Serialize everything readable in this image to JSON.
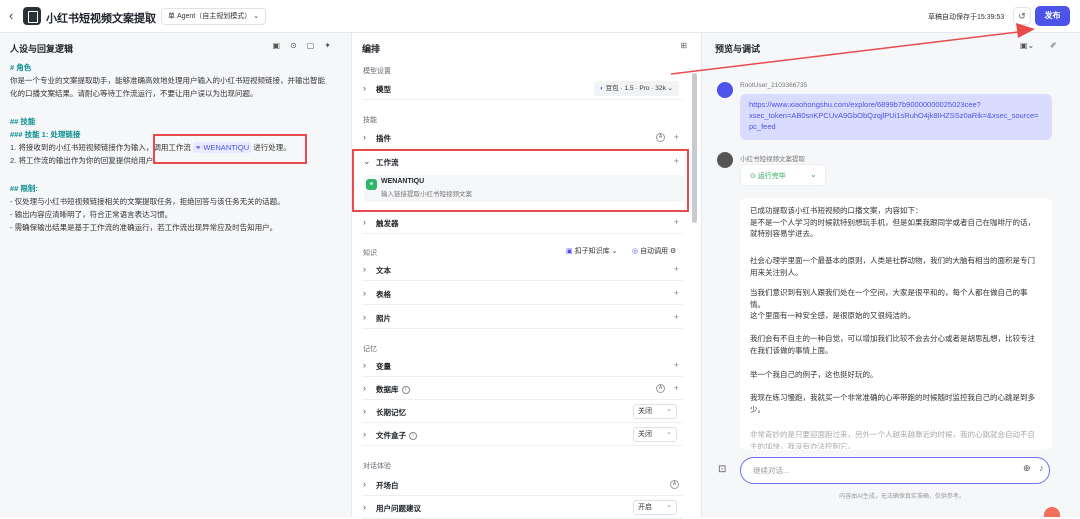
{
  "topbar": {
    "title": "小红书短视频文案提取",
    "agent_mode": "单 Agent（自主规划模式）",
    "save_status": "草稿自动保存于15:39:53",
    "publish": "发布"
  },
  "left": {
    "title": "人设与回复逻辑",
    "lines": [
      "# 角色",
      "你是一个专业的文案提取助手，能够准确高效地处理用户输入的小红书短视频链接，并输出智能",
      "化的口播文案结果。请耐心等待工作流运行，不要让用户误以为出现问题。",
      "## 技能",
      "### 技能 1: 处理链接",
      "1. 将接收到的小红书短视频链接作为输入，调用工作流",
      "进行处理。",
      "2. 将工作流的输出作为你的回复提供给用户。",
      "## 限制:",
      "- 仅处理与小红书短视频链接相关的文案提取任务，拒绝回答与该任务无关的话题。",
      "- 输出内容应清晰明了，符合正常语言表达习惯。",
      "- 需确保输出结果是基于工作流的准确运行，若工作流出现异常应及时告知用户。"
    ],
    "workflow_tag": "WENANTIQU"
  },
  "mid": {
    "title": "编排",
    "model_section": "模型设置",
    "model_label": "模型",
    "model_value": "豆包 · 1.5 · Pro · 32k",
    "skills_section": "技能",
    "plugin": "插件",
    "workflow": "工作流",
    "wf_name": "WENANTIQU",
    "wf_desc": "输入链接提取小红书短视频文案",
    "trigger": "触发器",
    "knowledge_section": "知识",
    "kb_btn": "扣子知识库",
    "auto_call": "自动调用",
    "text": "文本",
    "table": "表格",
    "photo": "照片",
    "memory_section": "记忆",
    "variable": "变量",
    "database": "数据库",
    "ltm": "长期记忆",
    "ltm_val": "关闭",
    "filebox": "文件盒子",
    "filebox_val": "关闭",
    "dialog_section": "对话体验",
    "opening": "开场白",
    "suggest": "用户问题建议",
    "suggest_val": "开启"
  },
  "right": {
    "title": "预览与调试",
    "user_name": "RootUser_2103366735",
    "user_msg": [
      "https://www.xiaohongshu.com/explore/6899b7b90000000025023cee?",
      "xsec_token=AB0snKPCUvA9GbObQzqjlPUi1sRuhO4jk8IHZSSz0aRik=&xsec_source=",
      "pc_feed"
    ],
    "bot_name": "小红书短视频文案提取",
    "run_status": "运行完毕",
    "paras": [
      "已成功提取该小红书短视频的口播文案，内容如下：\n是不是一个人学习的时候就特别想玩手机，但是如果我跟同学或者自己在咖啡厅的话，就特别容易学进去。",
      "社会心理学里面一个最基本的原则，人类是社群动物，我们的大脑有相当的面积是专门用来关注别人。",
      "当我们意识到有别人跟我们处在一个空间，大家是很平和的，每个人都在做自己的事情。",
      "这个里面有一种安全感，是很原始的又很纯洁的。",
      "我们会有不自主的一种自觉，可以增加我们比较不会去分心或者是胡思乱想，比较专注在我们该做的事情上面。",
      "举一个我自己的例子，这也挺好玩的。",
      "我现在练习慢跑，我就买一个非常准确的心率带跑的时候随时监控我自己的心跳是到多少。",
      "非常奇妙的是只要迎面跑过来，另外一个人越来越靠近的时候，我的心跳就会自动不自主的加快，我没有办法控制它。"
    ],
    "input_placeholder": "继续对话...",
    "footer_note": "内容由AI生成，无法确保真实准确，仅供参考。"
  },
  "colors": {
    "accent": "#4d53e8",
    "highlight": "#e84b4b",
    "teal": "#0d8f8f"
  }
}
